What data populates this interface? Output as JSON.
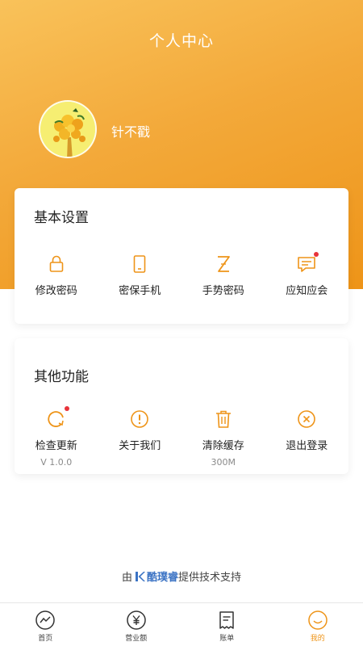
{
  "header": {
    "title": "个人中心"
  },
  "profile": {
    "name": "针不戳"
  },
  "basic_settings": {
    "title": "基本设置",
    "items": [
      {
        "label": "修改密码",
        "icon": "lock-icon"
      },
      {
        "label": "密保手机",
        "icon": "phone-icon"
      },
      {
        "label": "手势密码",
        "icon": "gesture-z-icon"
      },
      {
        "label": "应知应会",
        "icon": "message-icon",
        "badge": true
      }
    ]
  },
  "other_functions": {
    "title": "其他功能",
    "items": [
      {
        "label": "检查更新",
        "sub": "V 1.0.0",
        "icon": "refresh-icon",
        "badge": true
      },
      {
        "label": "关于我们",
        "sub": "",
        "icon": "info-icon"
      },
      {
        "label": "清除缓存",
        "sub": "300M",
        "icon": "trash-icon"
      },
      {
        "label": "退出登录",
        "sub": "",
        "icon": "close-circle-icon"
      }
    ]
  },
  "credit": {
    "prefix": "由",
    "brand": "酷璞睿",
    "suffix": "提供技术支持"
  },
  "tabbar": {
    "items": [
      {
        "label": "首页",
        "icon": "chart-line-icon"
      },
      {
        "label": "营业额",
        "icon": "yen-icon"
      },
      {
        "label": "账单",
        "icon": "receipt-icon"
      },
      {
        "label": "我的",
        "icon": "smile-icon",
        "active": true
      }
    ]
  },
  "colors": {
    "accent": "#ee9418",
    "badge": "#e8333a",
    "brand": "#3b73c4"
  }
}
